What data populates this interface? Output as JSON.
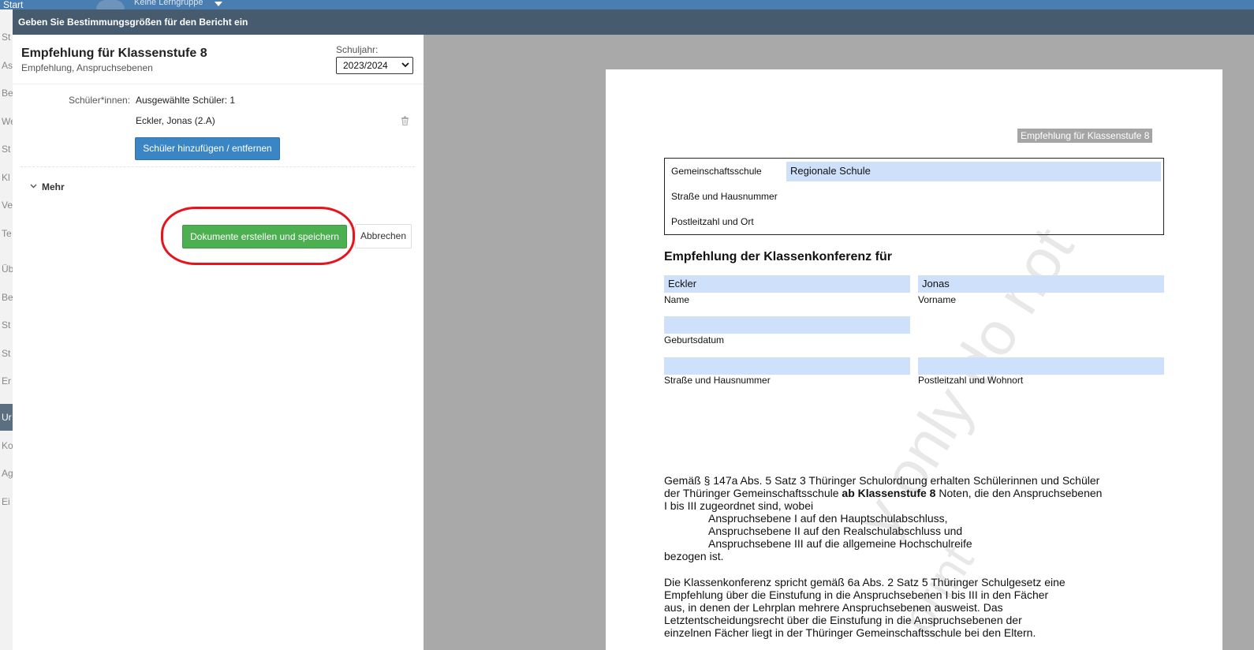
{
  "background_app": {
    "top_nav_label": "Start",
    "group_selector": "Keine Lerngruppe",
    "sidebar_items": [
      "St",
      "As",
      "Be",
      "We",
      "St",
      "Kl",
      "Ve",
      "Te",
      "Üb",
      "Be",
      "St",
      "St",
      "Er",
      "Ko",
      "Ag",
      "Ei"
    ],
    "sidebar_active_item": "Ur"
  },
  "dialog": {
    "title": "Geben Sie Bestimmungsgrößen für den Bericht ein"
  },
  "report": {
    "title": "Empfehlung für Klassenstufe 8",
    "subtitle": "Empfehlung, Anspruchsebenen",
    "school_year_label": "Schuljahr:",
    "school_year_value": "2023/2024"
  },
  "students": {
    "label": "Schüler*innen:",
    "selected_count_text": "Ausgewählte Schüler: 1",
    "entries": [
      "Eckler, Jonas (2.A)"
    ],
    "add_remove_button": "Schüler hinzufügen / entfernen"
  },
  "more": {
    "label": "Mehr"
  },
  "actions": {
    "create_button": "Dokumente erstellen und speichern",
    "cancel_button": "Abbrechen"
  },
  "document": {
    "badge": "Empfehlung für Klassenstufe 8",
    "school_type_label": "Gemeinschaftsschule",
    "school_type_value": "Regionale Schule",
    "street_label": "Straße und Hausnummer",
    "postal_label": "Postleitzahl und Ort",
    "heading": "Empfehlung der Klassenkonferenz für",
    "last_name_value": "Eckler",
    "last_name_label": "Name",
    "first_name_value": "Jonas",
    "first_name_label": "Vorname",
    "birthdate_label": "Geburtsdatum",
    "student_street_label": "Straße und Hausnummer",
    "student_postal_label": "Postleitzahl und Wohnort",
    "para1_a": "Gemäß § 147a Abs. 5 Satz 3 Thüringer Schulordnung erhalten Schülerinnen und Schüler der Thüringer Gemeinschaftsschule ",
    "para1_bold": "ab Klassenstufe 8",
    "para1_b": " Noten, die den Anspruchsebenen I bis III zugeordnet sind, wobei",
    "para1_list": [
      "Anspruchsebene I auf den Hauptschulabschluss,",
      "Anspruchsebene II auf den Realschulabschluss und",
      "Anspruchsebene III auf die allgemeine Hochschulreife"
    ],
    "para1_end": "bezogen ist.",
    "para2": "Die Klassenkonferenz spricht gemäß 6a Abs. 2 Satz 5 Thüringer Schulgesetz eine Empfehlung über die Einstufung in die Anspruchsebenen I bis III in den Fächer aus, in denen der Lehrplan mehrere Anspruchsebenen ausweist. Das Letztentscheidungsrecht über die Einstufung in die Anspruchsebenen der einzelnen Fächer liegt in der Thüringer Gemeinschaftsschule bei den Eltern.",
    "watermark_1": "y only do not",
    "watermark_2": "print"
  }
}
